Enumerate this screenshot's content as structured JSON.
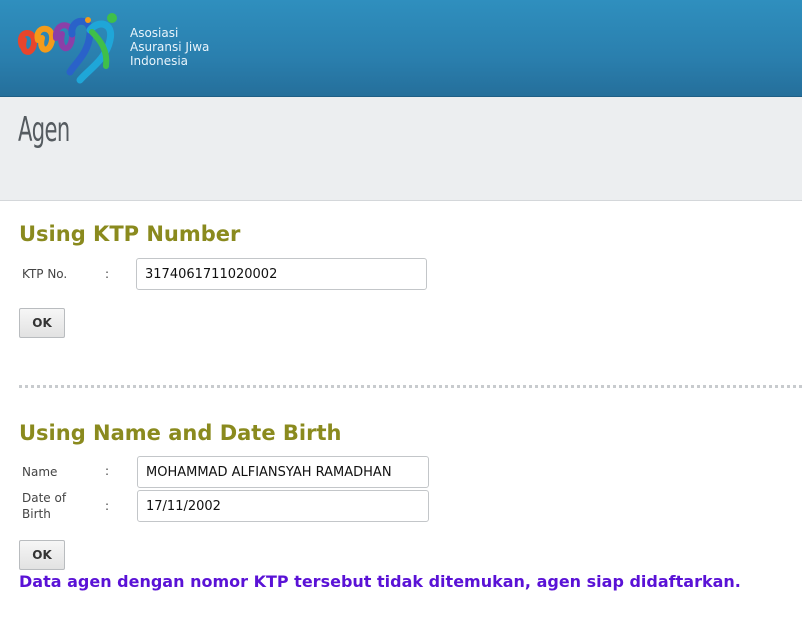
{
  "header": {
    "org_name_lines": [
      "Asosiasi",
      "Asuransi Jiwa",
      "Indonesia"
    ]
  },
  "page": {
    "title": "Agen"
  },
  "ktp_section": {
    "title": "Using KTP Number",
    "ktp_label": "KTP No.",
    "colon": ":",
    "ktp_value": "3174061711020002",
    "ok_label": "OK"
  },
  "name_section": {
    "title": "Using Name and Date Birth",
    "name_label": "Name",
    "dob_label_line1": "Date of",
    "dob_label_line2": "Birth",
    "colon": ":",
    "name_value": "MOHAMMAD ALFIANSYAH RAMADHAN",
    "dob_value": "17/11/2002",
    "ok_label": "OK"
  },
  "status": {
    "message": "Data agen dengan nomor KTP tersebut tidak ditemukan, agen siap didaftarkan.",
    "color": "#5a12d6"
  },
  "colors": {
    "header_bg": "#2a7fae",
    "section_title": "#8a8a1e"
  }
}
